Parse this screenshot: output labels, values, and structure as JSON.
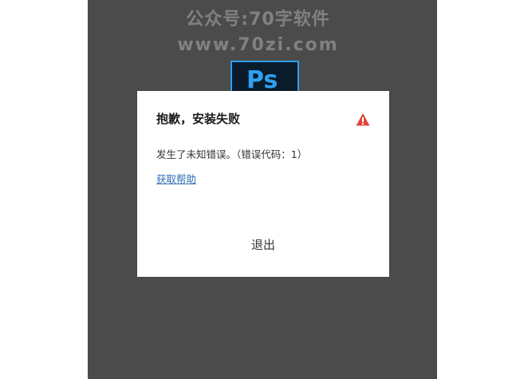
{
  "watermark": {
    "line1": "公众号:70字软件",
    "line2": "www.70zi.com"
  },
  "app_logo": {
    "text": "Ps",
    "accent": "#2da0f0",
    "background": "#0a1b2c"
  },
  "dialog": {
    "title": "抱歉，安装失败",
    "icon": "warning-icon",
    "message": "发生了未知错误。（错误代码：1）",
    "help_link": "获取帮助",
    "exit_label": "退出"
  },
  "colors": {
    "window_background": "#4b4b4b",
    "warning": "#e0453a",
    "link": "#2e6fb7"
  }
}
